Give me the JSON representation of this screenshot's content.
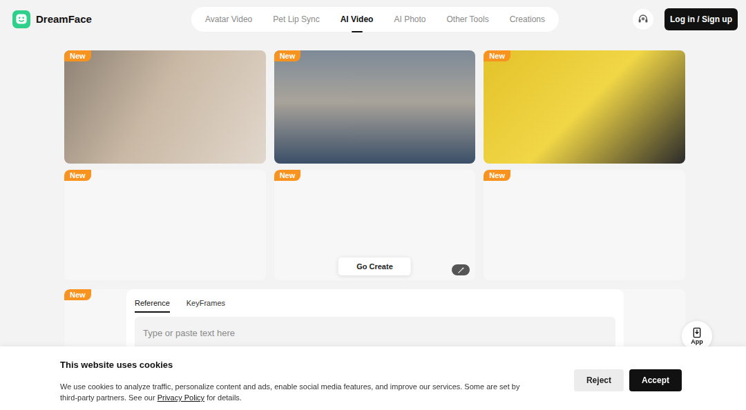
{
  "logo": {
    "text": "DreamFace"
  },
  "nav": [
    {
      "label": "Avatar Video",
      "selected": false
    },
    {
      "label": "Pet Lip Sync",
      "selected": false
    },
    {
      "label": "AI Video",
      "selected": true
    },
    {
      "label": "AI Photo",
      "selected": false
    },
    {
      "label": "Other Tools",
      "selected": false
    },
    {
      "label": "Creations",
      "selected": false
    }
  ],
  "header": {
    "login": "Log in / Sign up"
  },
  "gallery": [
    {
      "badge": "New",
      "kind": "photo"
    },
    {
      "badge": "New",
      "kind": "photo"
    },
    {
      "badge": "New",
      "kind": "photo"
    },
    {
      "badge": "New",
      "kind": "empty"
    },
    {
      "badge": "New",
      "kind": "empty"
    },
    {
      "badge": "New",
      "kind": "empty"
    },
    {
      "badge": "New",
      "kind": "empty"
    },
    {
      "kind": "empty"
    },
    {
      "kind": "empty"
    }
  ],
  "create_button": "Go Create",
  "prompt": {
    "tabs": [
      {
        "label": "Reference",
        "selected": true
      },
      {
        "label": "KeyFrames",
        "selected": false
      }
    ],
    "placeholder": "Type or paste text here"
  },
  "app_button": "App",
  "cookie": {
    "title": "This website uses cookies",
    "text_before": "We use cookies to analyze traffic, personalize content and ads, enable social media features, and improve our services. Some are set by third-party partners. See our ",
    "link": "Privacy Policy",
    "text_after": " for details.",
    "buttons": [
      {
        "label": "Reject",
        "kind": "secondary"
      },
      {
        "label": "Accept",
        "kind": "primary"
      }
    ]
  }
}
